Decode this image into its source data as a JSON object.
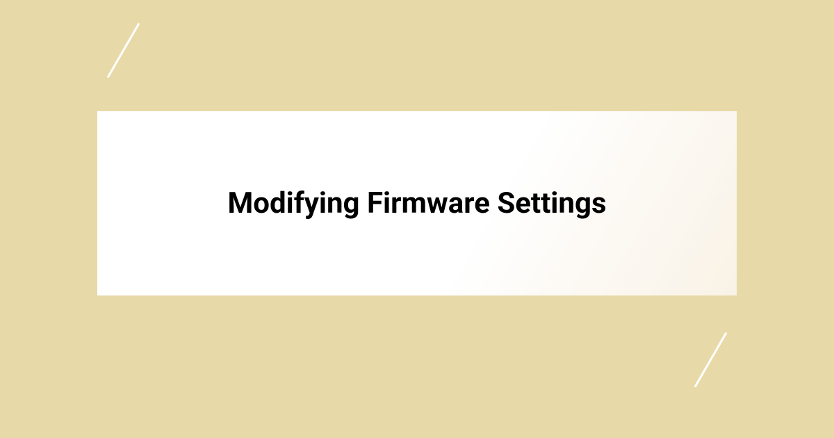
{
  "title": "Modifying Firmware Settings"
}
